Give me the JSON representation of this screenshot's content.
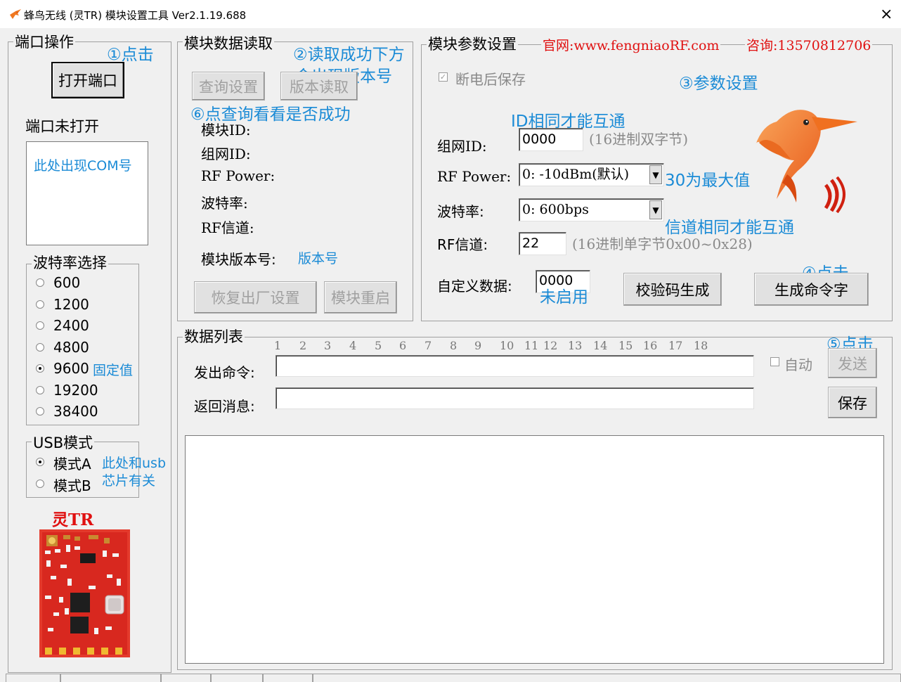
{
  "window": {
    "title": "蜂鸟无线 (灵TR) 模块设置工具 Ver2.1.19.688",
    "close": "×"
  },
  "port": {
    "group_title": "端口操作",
    "open_button": "打开端口",
    "status": "端口未打开",
    "com_hint": "此处出现COM号",
    "anno_click": "①点击"
  },
  "baud": {
    "group_title": "波特率选择",
    "options": [
      "600",
      "1200",
      "2400",
      "4800",
      "9600",
      "19200",
      "38400"
    ],
    "selected": "9600",
    "anno_fixed": "固定值"
  },
  "usb": {
    "group_title": "USB模式",
    "mode_a": "模式A",
    "mode_b": "模式B",
    "selected": "模式A",
    "anno_line1": "此处和usb",
    "anno_line2": "芯片有关"
  },
  "chip": {
    "label": "灵TR"
  },
  "read": {
    "group_title": "模块数据读取",
    "query_button": "查询设置",
    "version_button": "版本读取",
    "module_id": "模块ID:",
    "net_id": "组网ID:",
    "rf_power": "RF Power:",
    "baud_rate": "波特率:",
    "rf_channel": "RF信道:",
    "version_label": "模块版本号:",
    "version_value": "版本号",
    "reset_button": "恢复出厂设置",
    "reboot_button": "模块重启",
    "anno_read_line1": "②读取成功下方",
    "anno_read_line2": "会出现版本号",
    "anno_query": "⑥点查询看看是否成功"
  },
  "params": {
    "group_title": "模块参数设置",
    "website": "官网:www.fengniaoRF.com",
    "consult": "咨询:13570812706",
    "save_after_poweroff": "断电后保存",
    "anno_param": "③参数设置",
    "anno_id_same": "ID相同才能互通",
    "net_id_label": "组网ID:",
    "net_id_value": "0000",
    "net_id_hint": "(16进制双字节)",
    "rf_power_label": "RF Power:",
    "rf_power_value": "0: -10dBm(默认)",
    "anno_max": "30为最大值",
    "baud_label": "波特率:",
    "baud_value": "0: 600bps",
    "anno_channel_same": "信道相同才能互通",
    "channel_label": "RF信道:",
    "channel_value": "22",
    "channel_hint": "(16进制单字节0x00~0x28)",
    "custom_label": "自定义数据:",
    "custom_value": "0000",
    "anno_unused": "未启用",
    "checksum_button": "校验码生成",
    "generate_button": "生成命令字",
    "anno_click4": "④点击"
  },
  "datalist": {
    "group_title": "数据列表",
    "ruler": [
      "1",
      "2",
      "3",
      "4",
      "5",
      "6",
      "7",
      "8",
      "9",
      "10",
      "11",
      "12",
      "13",
      "14",
      "15",
      "16",
      "17",
      "18"
    ],
    "send_label": "发出命令:",
    "recv_label": "返回消息:",
    "auto_label": "自动",
    "send_button": "发送",
    "save_button": "保存",
    "anno_click5": "⑤点击"
  }
}
